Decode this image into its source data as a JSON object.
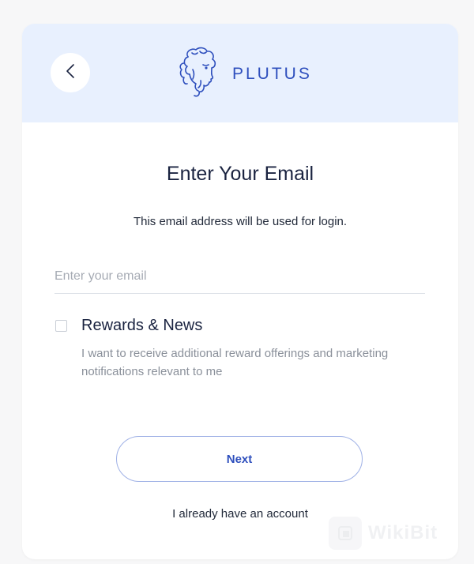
{
  "header": {
    "brand_name": "PLUTUS",
    "back_icon": "chevron-left-icon",
    "logo_icon": "zeus-head-icon"
  },
  "form": {
    "title": "Enter Your Email",
    "subtitle": "This email address will be used for login.",
    "email_placeholder": "Enter your email",
    "email_value": ""
  },
  "rewards": {
    "checked": false,
    "title": "Rewards & News",
    "description": "I want to receive additional reward offerings and marketing notifications relevant to me"
  },
  "actions": {
    "next_label": "Next",
    "account_link": "I already have an account"
  },
  "watermark": {
    "text": "WikiBit"
  },
  "colors": {
    "accent": "#2e4fbd",
    "header_bg": "#e8f0fe",
    "text_dark": "#1a2340",
    "text_muted": "#8a909a"
  }
}
